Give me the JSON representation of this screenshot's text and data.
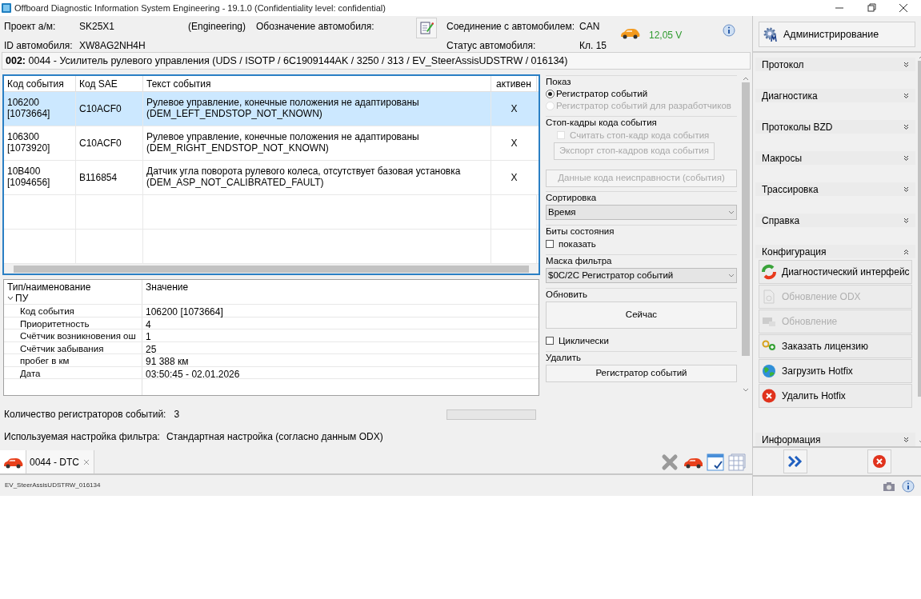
{
  "window": {
    "title": "Offboard Diagnostic Information System Engineering - 19.1.0 (Confidentiality level: confidential)"
  },
  "header": {
    "project_label": "Проект а/м:",
    "project_value": "SK25X1",
    "mode": "(Engineering)",
    "designation_label": "Обозначение автомобиля:",
    "vehicle_id_label": "ID автомобиля:",
    "vehicle_id_value": "XW8AG2NH4H",
    "connection_label": "Соединение с автомобилем:",
    "connection_value": "CAN",
    "status_label": "Статус автомобиля:",
    "status_value": "Кл. 15",
    "voltage": "12,05 V"
  },
  "module_line": "**002:** 0044 - Усилитель рулевого управления  (UDS / ISOTP / 6C1909144AK / 3250 / 313 / EV_SteerAssisUDSTRW / 016134)",
  "event_table": {
    "columns": [
      "Код события",
      "Код SAE",
      "Текст события",
      "активен"
    ],
    "rows": [
      {
        "selected": true,
        "code": [
          "106200",
          "[1073664]"
        ],
        "sae": "C10ACF0",
        "text": [
          "Рулевое управление, конечные положения не адаптированы",
          "(DEM_LEFT_ENDSTOP_NOT_KNOWN)"
        ],
        "active": "X"
      },
      {
        "selected": false,
        "code": [
          "106300",
          "[1073920]"
        ],
        "sae": "C10ACF0",
        "text": [
          "Рулевое управление, конечные положения не адаптированы",
          "(DEM_RIGHT_ENDSTOP_NOT_KNOWN)"
        ],
        "active": "X"
      },
      {
        "selected": false,
        "code": [
          "10B400",
          "[1094656]"
        ],
        "sae": "B116854",
        "text": [
          "Датчик угла поворота рулевого колеса, отсутствует базовая установка",
          "(DEM_ASP_NOT_CALIBRATED_FAULT)"
        ],
        "active": "X"
      }
    ]
  },
  "details": {
    "columns": [
      "Тип/наименование",
      "Значение"
    ],
    "group": {
      "label": "ПУ",
      "expanded": true,
      "children": [
        {
          "name": "Код события",
          "value": "106200 [1073664]"
        },
        {
          "name": "Приоритетность",
          "value": "4"
        },
        {
          "name": "Счётчик возникновения ош",
          "value": "1"
        },
        {
          "name": "Счётчик забывания",
          "value": "25"
        },
        {
          "name": "пробег в км",
          "value": "91 388 км"
        },
        {
          "name": "Дата",
          "value": "03:50:45 - 02.01.2026"
        }
      ]
    }
  },
  "summary": {
    "count_label": "Количество регистраторов событий:",
    "count_value": "3",
    "filter_label": "Используемая настройка фильтра:",
    "filter_value": "Стандартная настройка (согласно данным ODX)",
    "progress": {
      "level": 0
    }
  },
  "tabs": [
    {
      "label": "0044 - DTC",
      "selected": true
    }
  ],
  "status_bar": "EV_SteerAssisUDSTRW_016134",
  "options": [
    {
      "title": "Показ",
      "controls": [
        {
          "kind": "radio",
          "label": "Регистратор событий",
          "selected": true,
          "disabled": false
        },
        {
          "kind": "radio",
          "label": "Регистратор событий для разработчиков",
          "selected": false,
          "disabled": true
        }
      ]
    },
    {
      "title": "Стоп-кадры кода события",
      "controls": [
        {
          "kind": "checkbox",
          "label": "Считать стоп-кадр кода события",
          "checked": false,
          "disabled": true
        },
        {
          "kind": "button",
          "label": "Экспорт стоп-кадров кода события",
          "disabled": true
        }
      ]
    },
    {
      "controls": [
        {
          "kind": "button",
          "label": "Данные кода неисправности (события)",
          "disabled": true
        }
      ]
    },
    {
      "title": "Сортировка",
      "controls": [
        {
          "kind": "select",
          "value": "Время"
        }
      ]
    },
    {
      "title": "Биты состояния",
      "controls": [
        {
          "kind": "checkbox",
          "label": "показать",
          "checked": false,
          "disabled": false
        }
      ]
    },
    {
      "title": "Маска фильтра",
      "controls": [
        {
          "kind": "select",
          "value": "$0C/2C Регистратор событий"
        }
      ]
    },
    {
      "title": "Обновить",
      "controls": [
        {
          "kind": "bigbutton",
          "label": "Сейчас",
          "disabled": false
        },
        {
          "kind": "checkbox",
          "label": "Циклически",
          "checked": false,
          "disabled": false
        }
      ]
    },
    {
      "title": "Удалить",
      "controls": [
        {
          "kind": "button",
          "label": "Регистратор событий",
          "disabled": false
        }
      ]
    }
  ],
  "sidebar": {
    "admin_button": "Администрирование",
    "sections": [
      {
        "label": "Протокол",
        "expanded": false
      },
      {
        "label": "Диагностика",
        "expanded": false
      },
      {
        "label": "Протоколы BZD",
        "expanded": false
      },
      {
        "label": "Макросы",
        "expanded": false
      },
      {
        "label": "Трассировка",
        "expanded": false
      },
      {
        "label": "Справка",
        "expanded": false
      },
      {
        "label": "Конфигурация",
        "expanded": true,
        "items": [
          {
            "label": "Диагностический интерфейс",
            "disabled": false,
            "kind": "interface"
          },
          {
            "label": "Обновление ODX",
            "disabled": true,
            "kind": "document"
          },
          {
            "label": "Обновление",
            "disabled": true,
            "kind": "monitor"
          },
          {
            "label": "Заказать лицензию",
            "disabled": false,
            "kind": "keys"
          },
          {
            "label": "Загрузить Hotfix",
            "disabled": false,
            "kind": "globe"
          },
          {
            "label": "Удалить Hotfix",
            "disabled": false,
            "kind": "remove"
          }
        ]
      },
      {
        "label": "Информация",
        "expanded": false
      }
    ]
  }
}
